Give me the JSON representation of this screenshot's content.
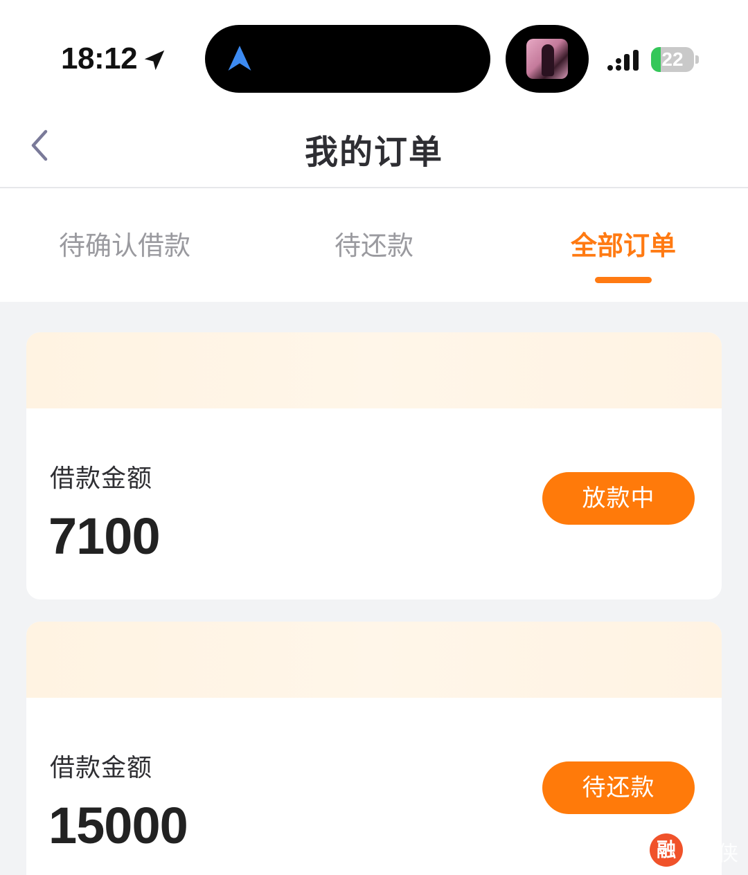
{
  "status_bar": {
    "time": "18:12",
    "battery_level": 22,
    "battery_text": "22"
  },
  "header": {
    "title": "我的订单"
  },
  "tabs": [
    {
      "label": "待确认借款",
      "active": false
    },
    {
      "label": "待还款",
      "active": false
    },
    {
      "label": "全部订单",
      "active": true
    }
  ],
  "orders": [
    {
      "amount_label": "借款金额",
      "amount": "7100",
      "status": "放款中"
    },
    {
      "amount_label": "借款金额",
      "amount": "15000",
      "status": "待还款"
    }
  ],
  "watermark": {
    "logo_char": "融",
    "text": "侠"
  },
  "colors": {
    "accent": "#ff7a12",
    "button": "#ff7a0a",
    "battery_green": "#34c759",
    "nav_arrow_blue": "#3d8bf2"
  },
  "icons": {
    "location": "location-arrow-icon",
    "navigation": "navigation-arrow-icon",
    "signal": "cellular-signal-icon",
    "back": "chevron-left-icon"
  }
}
